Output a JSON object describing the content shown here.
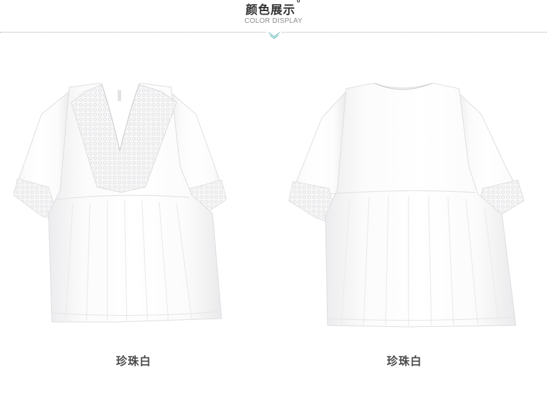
{
  "header": {
    "title": "颜色展示",
    "title_mark": "°",
    "subtitle": "COLOR DISPLAY",
    "divider_icon": "chevron-down-icon"
  },
  "products": [
    {
      "view": "front",
      "color_name": "珍珠白"
    },
    {
      "view": "back",
      "color_name": "珍珠白"
    }
  ],
  "colors": {
    "garment": "#ffffff",
    "garment_shadow": "#e9e9ea",
    "lace": "#f1f1f2",
    "accent": "#7fc7c6",
    "title_text": "#333333",
    "caption_text": "#4a4a4a"
  }
}
